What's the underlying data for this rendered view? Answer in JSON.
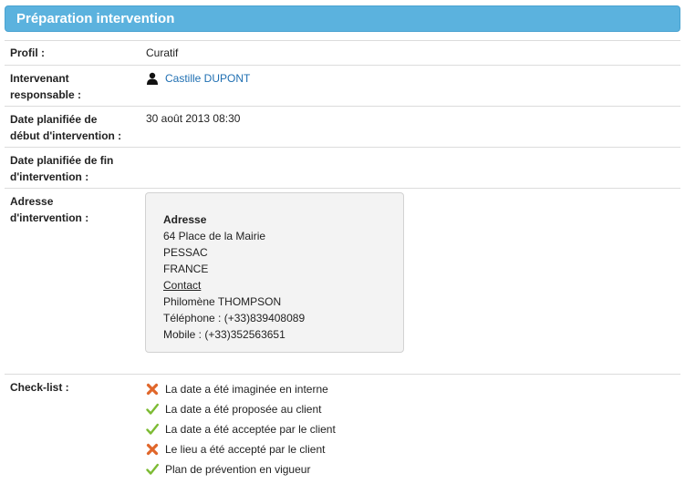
{
  "header": {
    "title": "Préparation intervention"
  },
  "fields": {
    "profil": {
      "label": "Profil :",
      "value": "Curatif"
    },
    "intervenant": {
      "label_line1": "Intervenant",
      "label_line2": "responsable :",
      "value": "Castille DUPONT",
      "icon": "person-icon"
    },
    "date_debut": {
      "label_line1": "Date planifiée de",
      "label_line2": "début d'intervention :",
      "value": "30 août 2013 08:30"
    },
    "date_fin": {
      "label_line1": "Date planifiée de fin",
      "label_line2": "d'intervention :",
      "value": ""
    },
    "adresse": {
      "label_line1": "Adresse",
      "label_line2": "d'intervention :",
      "box": {
        "heading": "Adresse",
        "street": "64 Place de la Mairie",
        "city": "PESSAC",
        "country": "FRANCE",
        "contact_heading": "Contact",
        "contact_name": "Philomène THOMPSON",
        "telephone": "Téléphone : (+33)839408089",
        "mobile": "Mobile : (+33)352563651"
      }
    }
  },
  "checklist": {
    "label": "Check-list :",
    "items": [
      {
        "text": "La date a été imaginée en interne",
        "status": "cross-icon"
      },
      {
        "text": "La date a été proposée au client",
        "status": "check-icon"
      },
      {
        "text": "La date a été acceptée par le client",
        "status": "check-icon"
      },
      {
        "text": "Le lieu a été accepté par le client",
        "status": "cross-icon"
      },
      {
        "text": "Plan de prévention en vigueur",
        "status": "check-icon"
      }
    ]
  },
  "colors": {
    "header": "#5bb2de",
    "link": "#1f6fb2",
    "check": "#7dbb34",
    "cross": "#e0662a"
  }
}
